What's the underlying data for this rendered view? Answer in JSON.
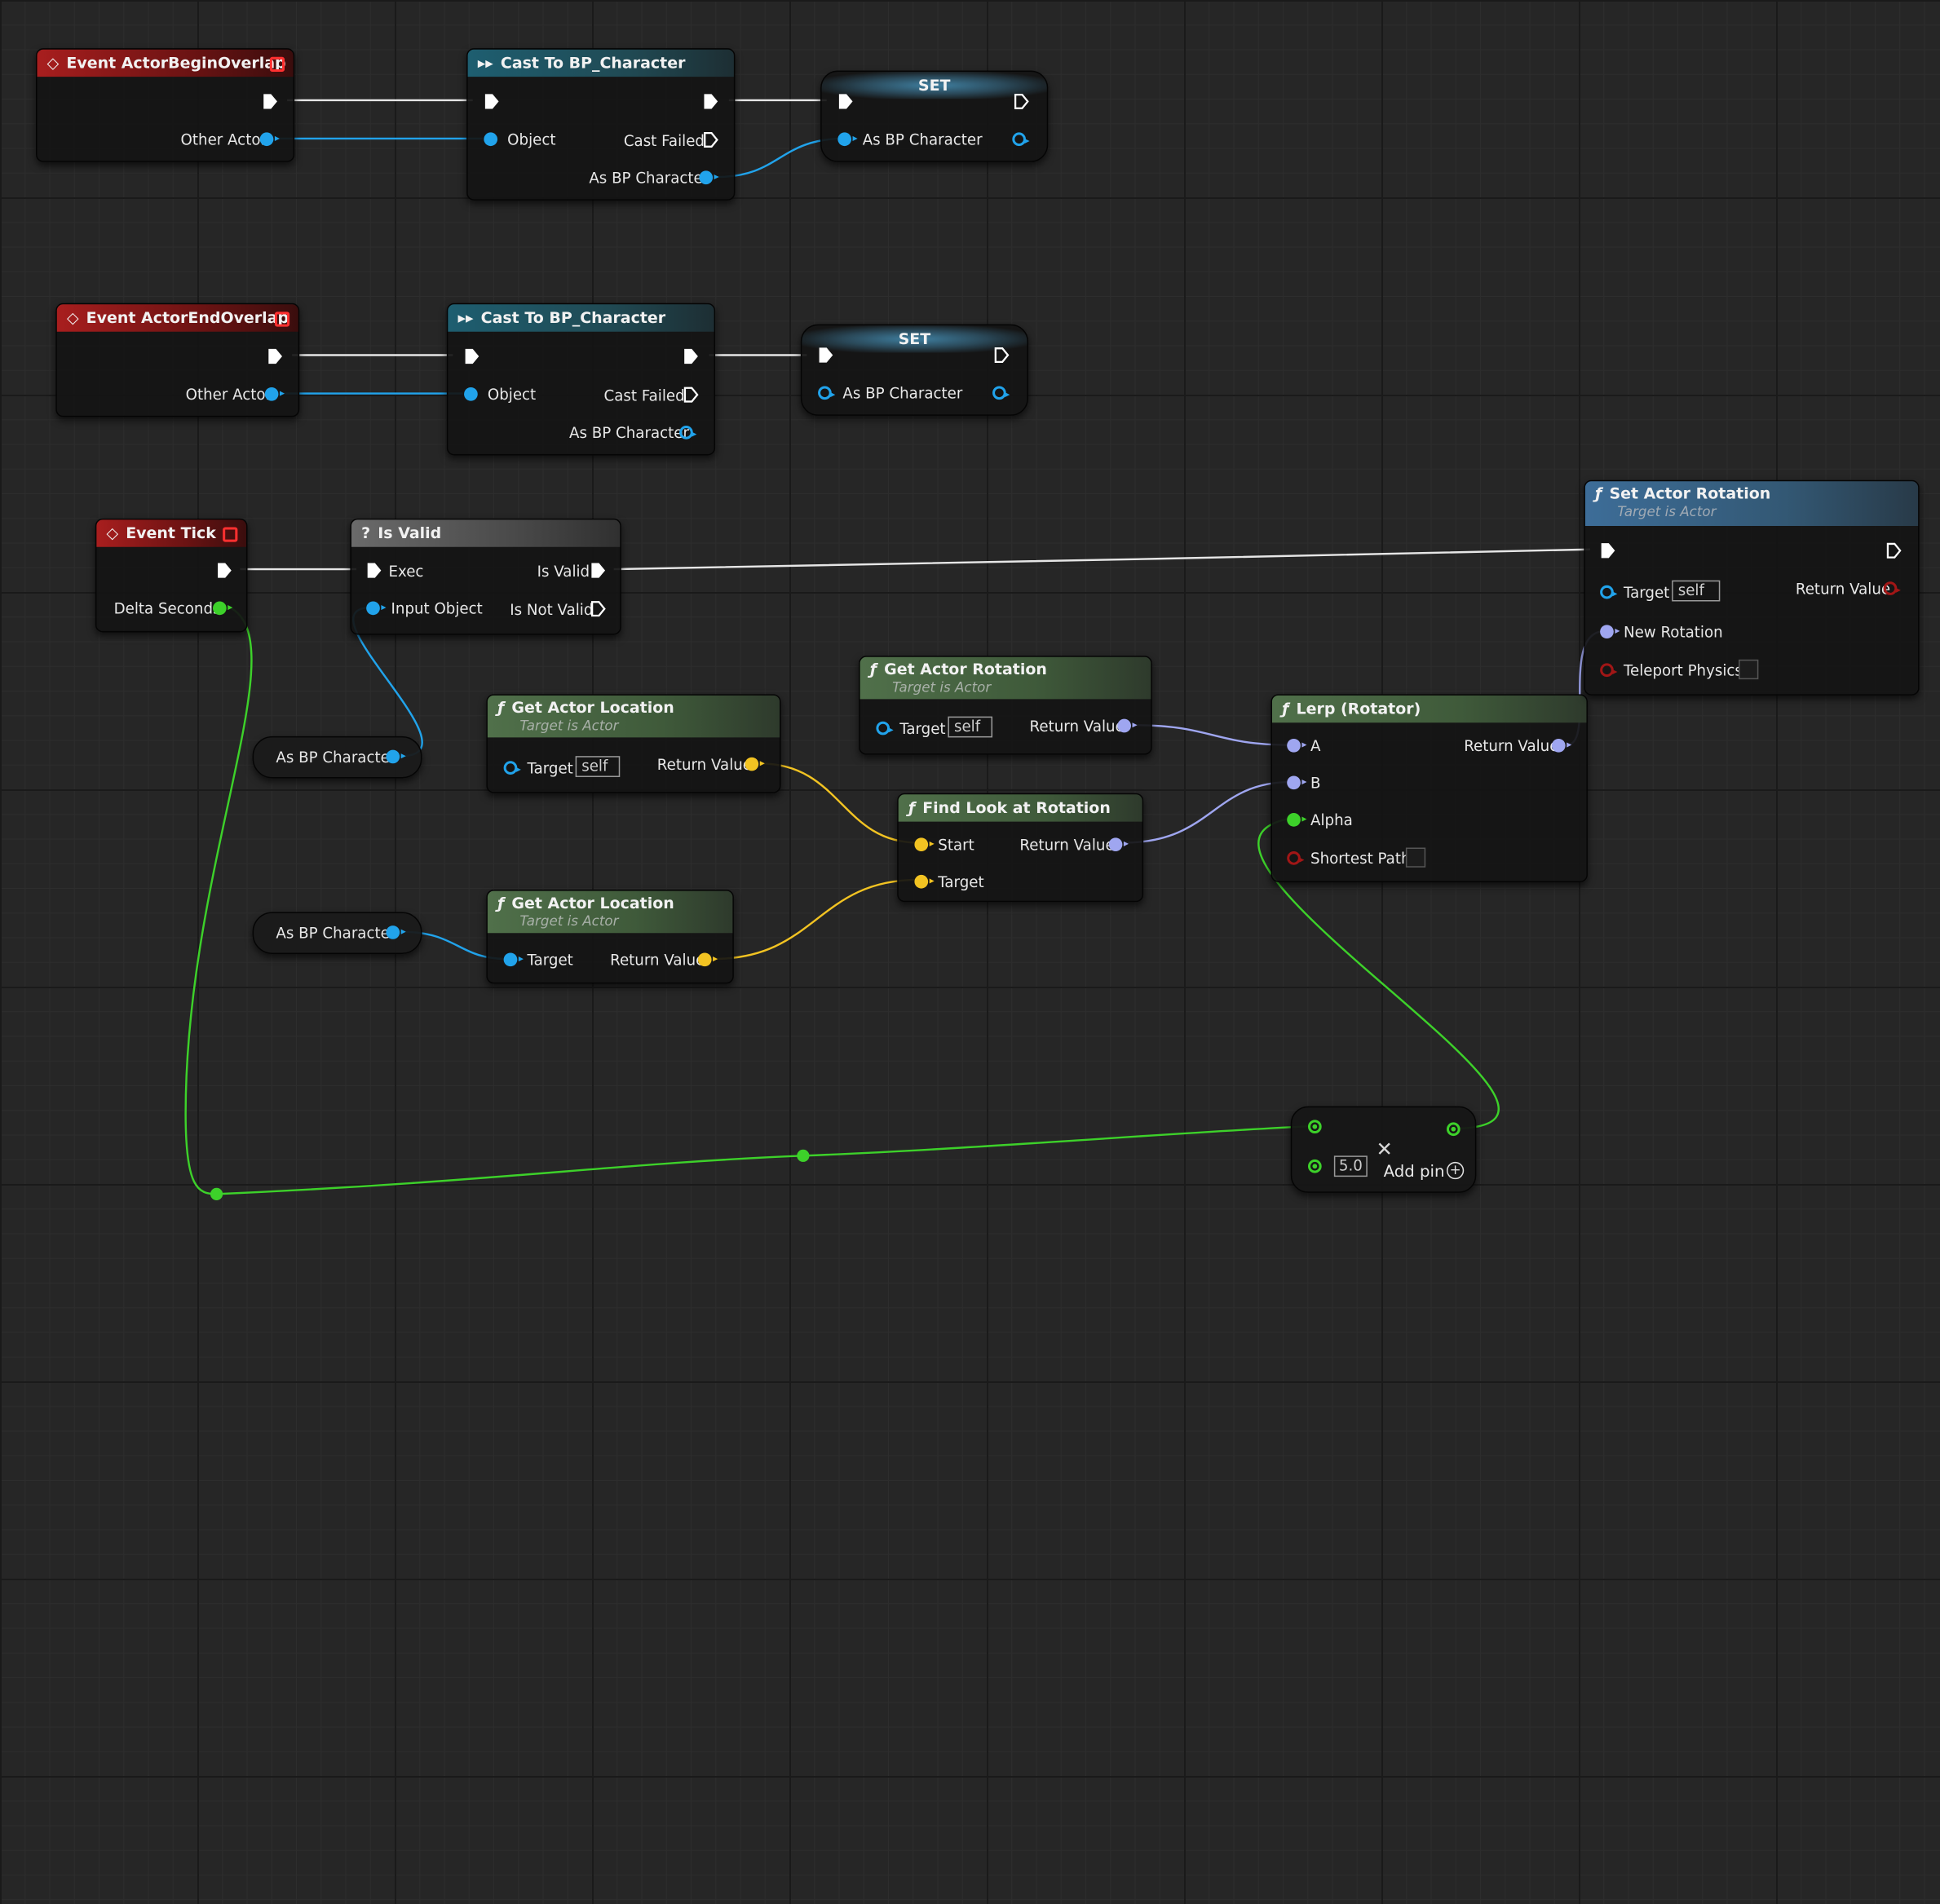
{
  "colors": {
    "object_pin": "#21a3eb",
    "float_pin": "#3dd12a",
    "vector_pin": "#f2c322",
    "rotator_pin": "#9fa6f0",
    "bool_pin": "#a11616",
    "exec_pin": "#ffffff"
  },
  "nodes": {
    "begin_overlap": {
      "title": "Event ActorBeginOverlap",
      "other_actor": "Other Actor"
    },
    "cast1": {
      "title": "Cast To BP_Character",
      "object": "Object",
      "cast_failed": "Cast Failed",
      "as_bp": "As BP Character"
    },
    "set1": {
      "title": "SET",
      "as_bp": "As BP Character"
    },
    "end_overlap": {
      "title": "Event ActorEndOverlap",
      "other_actor": "Other Actor"
    },
    "cast2": {
      "title": "Cast To BP_Character",
      "object": "Object",
      "cast_failed": "Cast Failed",
      "as_bp": "As BP Character"
    },
    "set2": {
      "title": "SET",
      "as_bp": "As BP Character"
    },
    "tick": {
      "title": "Event Tick",
      "delta": "Delta Seconds"
    },
    "is_valid": {
      "title": "Is Valid",
      "exec": "Exec",
      "is_valid": "Is Valid",
      "input_object": "Input Object",
      "is_not_valid": "Is Not Valid"
    },
    "var_get1": {
      "label": "As BP Character"
    },
    "var_get2": {
      "label": "As BP Character"
    },
    "get_loc1": {
      "title": "Get Actor Location",
      "subtitle": "Target is Actor",
      "target": "Target",
      "self": "self",
      "return": "Return Value"
    },
    "get_loc2": {
      "title": "Get Actor Location",
      "subtitle": "Target is Actor",
      "target": "Target",
      "return": "Return Value"
    },
    "get_rot": {
      "title": "Get Actor Rotation",
      "subtitle": "Target is Actor",
      "target": "Target",
      "self": "self",
      "return": "Return Value"
    },
    "find_look": {
      "title": "Find Look at Rotation",
      "start": "Start",
      "target": "Target",
      "return": "Return Value"
    },
    "lerp": {
      "title": "Lerp (Rotator)",
      "a": "A",
      "b": "B",
      "alpha": "Alpha",
      "shortest": "Shortest Path",
      "return": "Return Value"
    },
    "set_rot": {
      "title": "Set Actor Rotation",
      "subtitle": "Target is Actor",
      "target": "Target",
      "self": "self",
      "new_rot": "New Rotation",
      "teleport": "Teleport Physics",
      "return": "Return Value"
    },
    "multiply": {
      "value": "5.0",
      "add_pin": "Add pin"
    }
  }
}
